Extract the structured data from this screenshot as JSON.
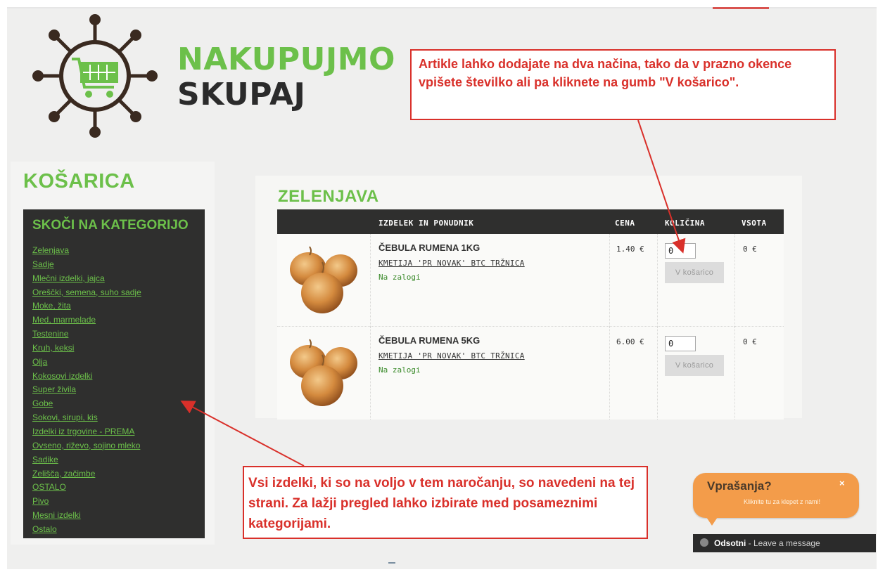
{
  "logo": {
    "line1": "NAKUPUJMO",
    "line2": "SKUPAJ"
  },
  "cart_title": "KOŠARICA",
  "categories": {
    "heading": "SKOČI NA KATEGORIJO",
    "items": [
      "Zelenjava",
      "Sadje",
      "Mlečni izdelki, jajca",
      "Oreščki, semena, suho sadje",
      "Moke, žita",
      "Med, marmelade",
      "Testenine",
      "Kruh, keksi",
      "Olja",
      "Kokosovi izdelki",
      "Super živila",
      "Gobe",
      "Sokovi, sirupi, kis",
      "Izdelki iz trgovine - PREMA",
      "Ovseno, riževo, sojino mleko",
      "Sadike",
      "Zelišča, začimbe",
      "OSTALO",
      "Pivo",
      "Mesni izdelki",
      "Ostalo"
    ]
  },
  "section_title": "ZELENJAVA",
  "table": {
    "headers": {
      "product": "IZDELEK IN PONUDNIK",
      "price": "CENA",
      "quantity": "KOLIČINA",
      "sum": "VSOTA"
    },
    "rows": [
      {
        "name": "ČEBULA RUMENA 1KG",
        "vendor": "KMETIJA 'PR NOVAK' BTC TRŽNICA",
        "stock": "Na zalogi",
        "price": "1.40 €",
        "quantity": "0",
        "button": "V košarico",
        "sum": "0 €"
      },
      {
        "name": "ČEBULA RUMENA 5KG",
        "vendor": "KMETIJA 'PR NOVAK' BTC TRŽNICA",
        "stock": "Na zalogi",
        "price": "6.00 €",
        "quantity": "0",
        "button": "V košarico",
        "sum": "0 €"
      }
    ]
  },
  "callouts": {
    "top": "Artikle lahko dodajate na dva načina, tako da v prazno okence vpišete številko ali pa kliknete na gumb \"V košarico\".",
    "bottom": "Vsi izdelki, ki so na voljo v tem naročanju, so navedeni na tej strani. Za lažji pregled lahko izbirate med posameznimi kategorijami."
  },
  "chat": {
    "title": "Vprašanja?",
    "subtitle": "Kliknite tu za klepet z nami!",
    "close": "×",
    "status_name": "Odsotni",
    "status_text": " - Leave a message"
  },
  "colors": {
    "accent_green": "#6cc04a",
    "dark_panel": "#2f2f2e",
    "callout_red": "#d9302a",
    "chat_orange": "#f39c4a"
  }
}
